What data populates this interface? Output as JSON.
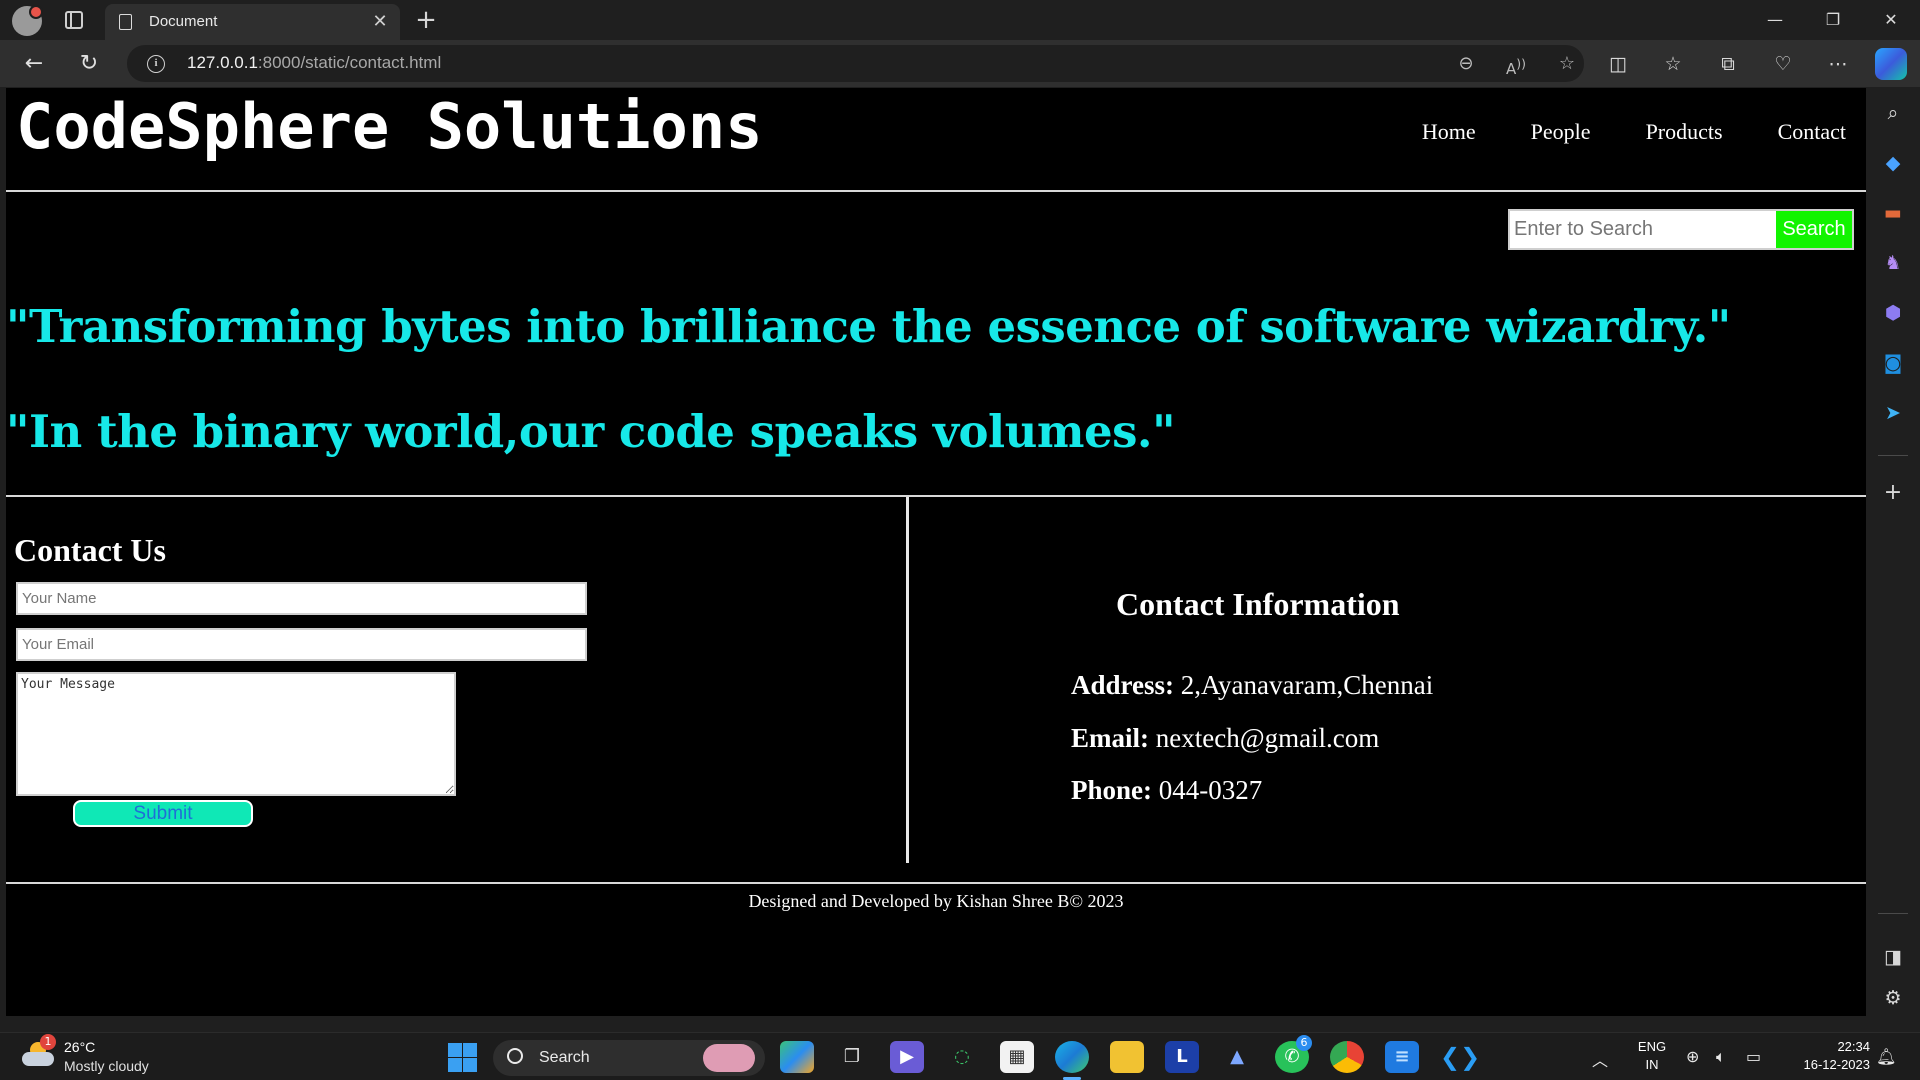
{
  "browser": {
    "tab_title": "Document",
    "url_host": "127.0.0.1",
    "url_rest": ":8000/static/contact.html"
  },
  "site": {
    "title": "CodeSphere Solutions",
    "nav": [
      "Home",
      "People",
      "Products",
      "Contact"
    ],
    "search_placeholder": "Enter to Search",
    "search_button": "Search",
    "quotes": [
      "\"Transforming bytes into brilliance the essence of software wizardry.\"",
      "\"In the binary world,our code speaks volumes.\""
    ],
    "contact_form": {
      "heading": "Contact Us",
      "name_placeholder": "Your Name",
      "email_placeholder": "Your Email",
      "message_placeholder": "Your Message",
      "submit_label": "Submit"
    },
    "contact_info": {
      "heading": "Contact Information",
      "address_label": "Address:",
      "address_value": " 2,Ayanavaram,Chennai",
      "email_label": "Email:",
      "email_value": " nextech@gmail.com",
      "phone_label": "Phone:",
      "phone_value": " 044-0327"
    },
    "footer": "Designed and Developed by Kishan Shree B© 2023"
  },
  "taskbar": {
    "weather_badge": "1",
    "temperature": "26°C",
    "condition": "Mostly cloudy",
    "search_label": "Search",
    "whatsapp_badge": "6",
    "lang_top": "ENG",
    "lang_bottom": "IN",
    "time": "22:34",
    "date": "16-12-2023"
  },
  "colors": {
    "quote": "#17e8e8",
    "search_button": "#11f400",
    "submit_button": "#0fe8b6"
  }
}
